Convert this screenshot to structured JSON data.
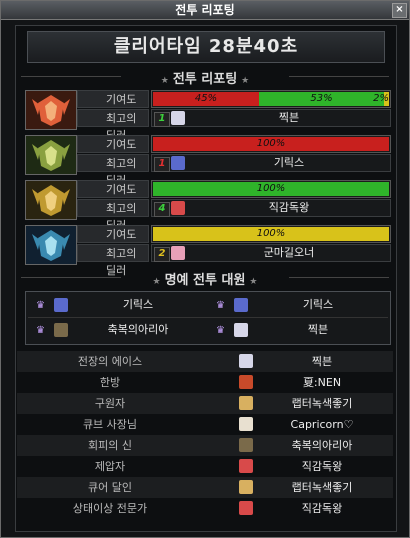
{
  "window": {
    "title": "전투 리포팅",
    "close_label": "×"
  },
  "banner": {
    "text": "클리어타임  28분40초"
  },
  "section_report": {
    "title": "전투 리포팅"
  },
  "section_honor": {
    "title": "명예 전투 대원"
  },
  "labels": {
    "contribution": "기여도",
    "best_dealer": "최고의 딜러"
  },
  "teams": [
    {
      "emblem": "red-crest-icon",
      "contribution": [
        {
          "label": "45%",
          "value": 45,
          "color": "#c8201e"
        },
        {
          "label": "53%",
          "value": 53,
          "color": "#2fb42a"
        },
        {
          "label": "2%",
          "value": 2,
          "color": "#d8c21a"
        }
      ],
      "dealer": {
        "rank": "1",
        "rank_color": "#3cd13c",
        "face_color": "#d6d6e8",
        "name": "찍븐"
      }
    },
    {
      "emblem": "green-crest-icon",
      "contribution": [
        {
          "label": "100%",
          "value": 100,
          "color": "#c8201e"
        }
      ],
      "dealer": {
        "rank": "1",
        "rank_color": "#e23030",
        "face_color": "#5a6acc",
        "name": "기릭스"
      }
    },
    {
      "emblem": "gold-crest-icon",
      "contribution": [
        {
          "label": "100%",
          "value": 100,
          "color": "#2fb42a"
        }
      ],
      "dealer": {
        "rank": "4",
        "rank_color": "#3cd13c",
        "face_color": "#d84a4a",
        "name": "직감독왕"
      }
    },
    {
      "emblem": "blue-crest-icon",
      "contribution": [
        {
          "label": "100%",
          "value": 100,
          "color": "#d8c21a"
        }
      ],
      "dealer": {
        "rank": "2",
        "rank_color": "#e0c020",
        "face_color": "#e8a0b8",
        "name": "군마길오너"
      }
    }
  ],
  "honor": [
    {
      "name": "기릭스",
      "face_color": "#5a6acc"
    },
    {
      "name": "기릭스",
      "face_color": "#5a6acc"
    },
    {
      "name": "축복의아리아",
      "face_color": "#7a6a4a"
    },
    {
      "name": "찍븐",
      "face_color": "#d6d6e8"
    }
  ],
  "awards": [
    {
      "title": "전장의 에이스",
      "player": "찍븐",
      "face_color": "#d6d6e8"
    },
    {
      "title": "한방",
      "player": "夏:NEN",
      "face_color": "#c84a2a"
    },
    {
      "title": "구원자",
      "player": "랩터녹색좋기",
      "face_color": "#d8b060"
    },
    {
      "title": "큐브 사장님",
      "player": "Capricorn♡",
      "face_color": "#e8e0d0"
    },
    {
      "title": "회피의 신",
      "player": "축복의아리아",
      "face_color": "#7a6a4a"
    },
    {
      "title": "제압자",
      "player": "직감독왕",
      "face_color": "#d84a4a"
    },
    {
      "title": "큐어 달인",
      "player": "랩터녹색좋기",
      "face_color": "#d8b060"
    },
    {
      "title": "상태이상 전문가",
      "player": "직감독왕",
      "face_color": "#d84a4a"
    }
  ]
}
